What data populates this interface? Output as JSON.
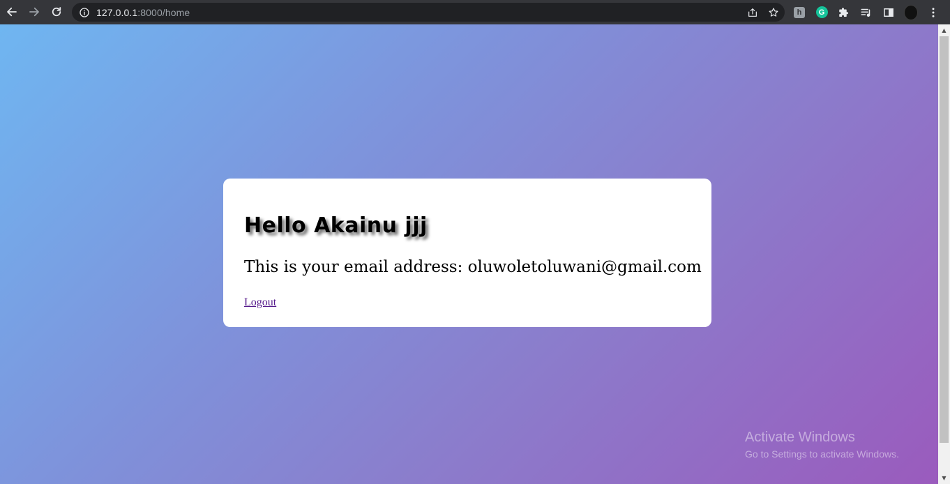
{
  "browser": {
    "url_host": "127.0.0.1",
    "url_path": ":8000/home",
    "icons": {
      "back": "arrow-left-icon",
      "forward": "arrow-right-icon",
      "reload": "reload-icon",
      "site_info": "info-icon",
      "share": "share-icon",
      "bookmark": "star-icon",
      "extensions": "puzzle-icon",
      "reading_list": "reading-list-icon",
      "side_panel": "side-panel-icon",
      "menu": "kebab-menu-icon"
    },
    "extension_h_label": "h",
    "extension_g_label": "G"
  },
  "page": {
    "greeting": "Hello Akainu jjj",
    "email_line": "This is your email address: oluwoletoluwani@gmail.com",
    "logout_label": "Logout"
  },
  "watermark": {
    "title": "Activate Windows",
    "subtitle": "Go to Settings to activate Windows."
  },
  "colors": {
    "gradient_start": "#6fb6f1",
    "gradient_end": "#9a5bbd",
    "card_bg": "#ffffff",
    "link_visited": "#551a8b"
  }
}
